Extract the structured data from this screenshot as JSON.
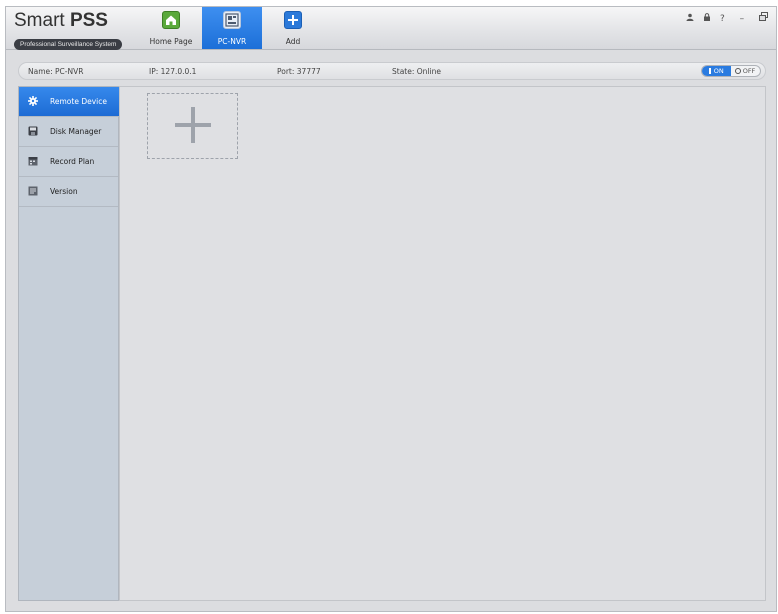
{
  "app": {
    "logo_title_light": "Smart ",
    "logo_title_bold": "PSS",
    "logo_subtitle": "Professional Surveillance System"
  },
  "nav": {
    "tabs": [
      {
        "label": "Home Page",
        "icon": "home-icon",
        "active": false
      },
      {
        "label": "PC-NVR",
        "icon": "nvr-icon",
        "active": true
      },
      {
        "label": "Add",
        "icon": "add-icon",
        "active": false
      }
    ]
  },
  "window_controls": {
    "user": "user-icon",
    "lock": "lock-icon",
    "help": "?",
    "minimize": "–",
    "restore": "restore-icon"
  },
  "info": {
    "name": "Name:  PC-NVR",
    "ip": "IP:  127.0.0.1",
    "port": "Port:   37777",
    "state": "State:   Online",
    "toggle_on": "ON",
    "toggle_off": "OFF"
  },
  "sidebar": {
    "items": [
      {
        "label": "Remote Device",
        "icon": "gear-icon",
        "active": true
      },
      {
        "label": "Disk Manager",
        "icon": "disk-icon",
        "active": false
      },
      {
        "label": "Record Plan",
        "icon": "calendar-icon",
        "active": false
      },
      {
        "label": "Version",
        "icon": "version-icon",
        "active": false
      }
    ]
  },
  "colors": {
    "accent": "#2a7be0",
    "sidebar_bg": "#c6cfd9",
    "main_bg": "#dfe0e3"
  }
}
